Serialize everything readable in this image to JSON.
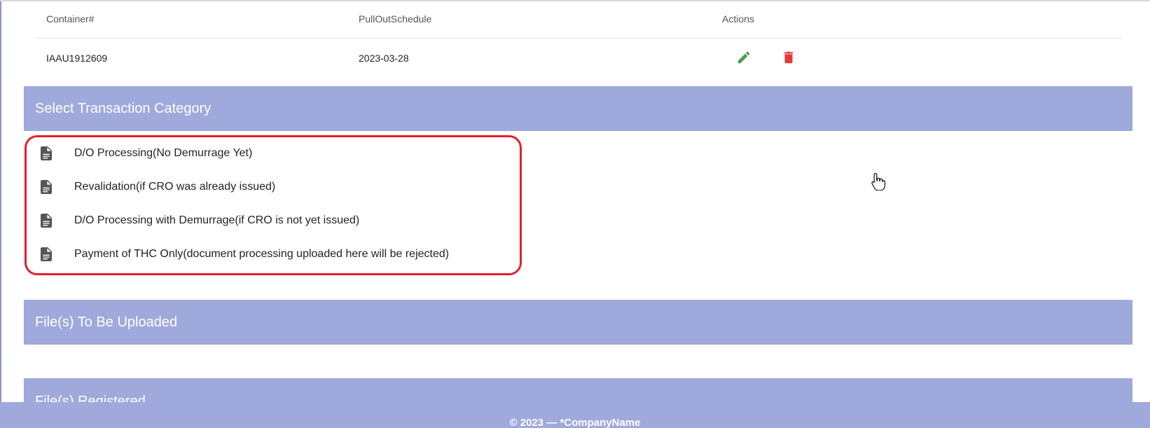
{
  "table": {
    "headers": {
      "container": "Container#",
      "pullout": "PullOutSchedule",
      "actions": "Actions"
    },
    "rows": [
      {
        "container": "IAAU1912609",
        "pullout": "2023-03-28",
        "edit_icon": "pencil-icon",
        "delete_icon": "trash-icon"
      }
    ]
  },
  "sections": {
    "transaction_category": "Select Transaction Category",
    "files_to_upload": "File(s) To Be Uploaded",
    "files_registered": "File(s) Registered"
  },
  "categories": [
    {
      "label": "D/O Processing(No Demurrage Yet)",
      "icon": "document-icon"
    },
    {
      "label": "Revalidation(if CRO was already issued)",
      "icon": "document-icon"
    },
    {
      "label": "D/O Processing with Demurrage(if CRO is not yet issued)",
      "icon": "document-icon"
    },
    {
      "label": "Payment of THC Only(document processing uploaded here will be rejected)",
      "icon": "document-icon"
    }
  ],
  "footer": {
    "text": "© 2023 — *CompanyName"
  },
  "colors": {
    "section_bar": "#9fa9db",
    "highlight_border": "#e3202c",
    "edit_icon": "#43a047",
    "delete_icon": "#e53935"
  }
}
